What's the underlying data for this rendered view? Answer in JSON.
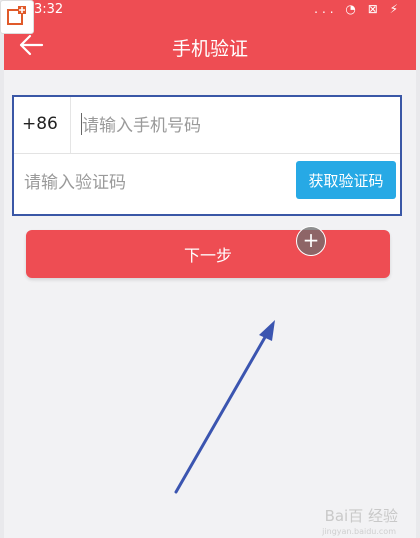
{
  "status_bar": {
    "time": "3:32",
    "icons": "... ◔ ⊠ ⚡"
  },
  "header": {
    "title": "手机验证"
  },
  "form": {
    "country_code": "+86",
    "phone_placeholder": "请输入手机号码",
    "code_placeholder": "请输入验证码",
    "get_code_label": "获取验证码"
  },
  "actions": {
    "next_label": "下一步"
  },
  "floating": {
    "plus_label": "+"
  },
  "watermark": {
    "text": "Bai百 经验",
    "sub": "jingyan.baidu.com"
  },
  "colors": {
    "brand_red": "#ee4d53",
    "action_blue": "#27a9e5",
    "highlight_box": "#3a57a6"
  }
}
